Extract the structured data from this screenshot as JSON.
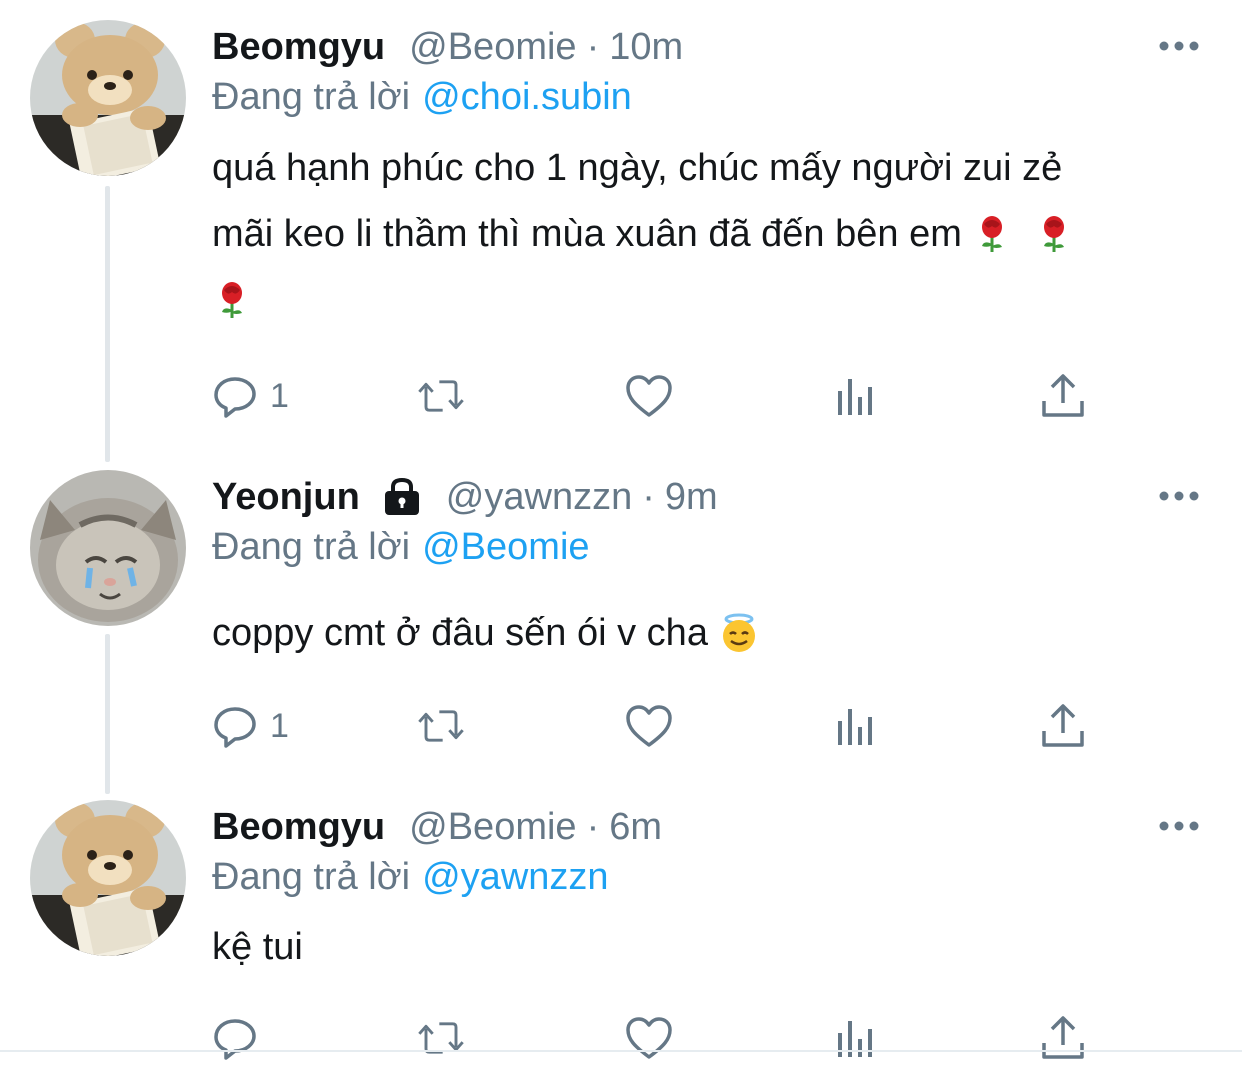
{
  "colors": {
    "link": "#1da1f2",
    "muted": "#657786",
    "text": "#14171a"
  },
  "tweets": [
    {
      "name": "Beomgyu",
      "handle": "@Beomie",
      "time": "10m",
      "protected": false,
      "reply_prefix": "Đang trả lời",
      "reply_to": "@choi.subin",
      "lines": [
        "quá hạnh phúc cho 1 ngày, chúc mấy người zui zẻ",
        "mãi keo li thầm thì mùa xuân đã đến bên em"
      ],
      "emojis": [
        "rose-emoji",
        "rose-emoji",
        "rose-emoji"
      ],
      "reply_count": "1",
      "avatar": "teddy-bear-reading-avatar"
    },
    {
      "name": "Yeonjun",
      "handle": "@yawnzzn",
      "time": "9m",
      "protected": true,
      "reply_prefix": "Đang trả lời",
      "reply_to": "@Beomie",
      "lines": [
        "coppy cmt ở đâu sến ói v cha"
      ],
      "emojis": [
        "smiling-face-with-halo-emoji"
      ],
      "reply_count": "1",
      "avatar": "crying-kitten-avatar"
    },
    {
      "name": "Beomgyu",
      "handle": "@Beomie",
      "time": "6m",
      "protected": false,
      "reply_prefix": "Đang trả lời",
      "reply_to": "@yawnzzn",
      "lines": [
        "kệ tui"
      ],
      "emojis": [],
      "reply_count": "",
      "avatar": "teddy-bear-reading-avatar"
    }
  ],
  "separator": "·",
  "icons": [
    "more-icon",
    "lock-icon",
    "reply-icon",
    "retweet-icon",
    "like-icon",
    "analytics-icon",
    "share-icon"
  ]
}
